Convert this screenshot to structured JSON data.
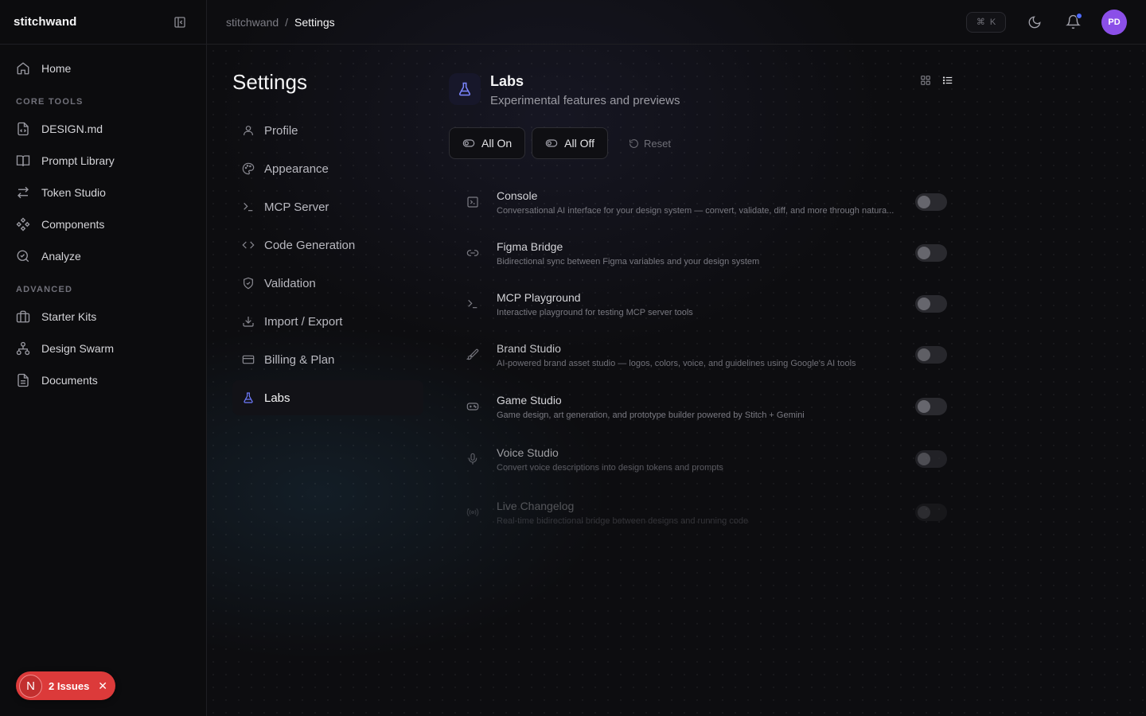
{
  "app": {
    "brand": "stitchwand"
  },
  "sidebar": {
    "home": "Home",
    "section_core": "CORE TOOLS",
    "core_items": [
      "DESIGN.md",
      "Prompt Library",
      "Token Studio",
      "Components",
      "Analyze"
    ],
    "section_advanced": "ADVANCED",
    "advanced_items": [
      "Starter Kits",
      "Design Swarm",
      "Documents"
    ]
  },
  "issues": {
    "letter": "N",
    "label": "2 Issues"
  },
  "topbar": {
    "crumb_root": "stitchwand",
    "crumb_sep": "/",
    "crumb_current": "Settings",
    "kbd_symbol": "⌘",
    "kbd_key": "K",
    "avatar": "PD",
    "notification_dot_color": "#4f6bff"
  },
  "settings": {
    "title": "Settings",
    "nav": [
      "Profile",
      "Appearance",
      "MCP Server",
      "Code Generation",
      "Validation",
      "Import / Export",
      "Billing & Plan",
      "Labs"
    ],
    "active": "Labs"
  },
  "labs": {
    "title": "Labs",
    "subtitle": "Experimental features and previews",
    "all_on": "All On",
    "all_off": "All Off",
    "reset": "Reset",
    "features": [
      {
        "name": "Console",
        "desc": "Conversational AI interface for your design system — convert, validate, diff, and more through natura...",
        "enabled": false
      },
      {
        "name": "Figma Bridge",
        "desc": "Bidirectional sync between Figma variables and your design system",
        "enabled": false
      },
      {
        "name": "MCP Playground",
        "desc": "Interactive playground for testing MCP server tools",
        "enabled": false
      },
      {
        "name": "Brand Studio",
        "desc": "AI-powered brand asset studio — logos, colors, voice, and guidelines using Google's AI tools",
        "enabled": false
      },
      {
        "name": "Game Studio",
        "desc": "Game design, art generation, and prototype builder powered by Stitch + Gemini",
        "enabled": false
      },
      {
        "name": "Voice Studio",
        "desc": "Convert voice descriptions into design tokens and prompts",
        "enabled": false
      },
      {
        "name": "Live Changelog",
        "desc": "Real-time bidirectional bridge between designs and running code",
        "enabled": false
      }
    ]
  },
  "colors": {
    "accent": "#6f7cff",
    "avatar_bg": "#8b4fe8",
    "issues_bg": "#dc3a3a"
  }
}
